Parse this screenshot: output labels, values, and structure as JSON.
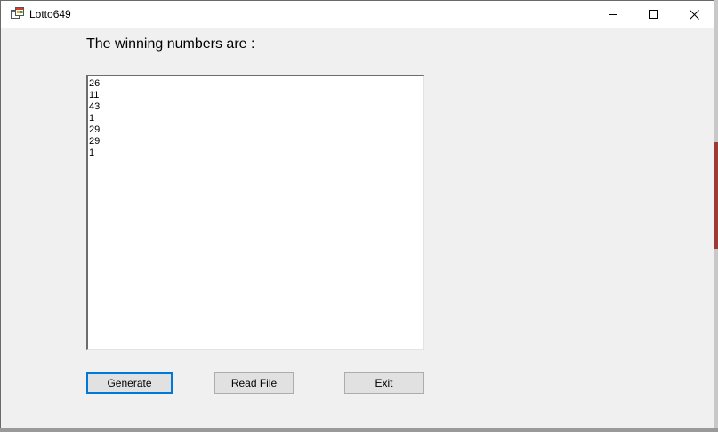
{
  "window": {
    "title": "Lotto649",
    "icon": "windows-form-icon"
  },
  "controls": {
    "minimize": "minimize-icon",
    "maximize": "maximize-icon",
    "close": "close-icon"
  },
  "main": {
    "heading": "The winning numbers are :",
    "numbers": [
      "26",
      "11",
      "43",
      "1",
      "29",
      "29",
      "1"
    ]
  },
  "buttons": {
    "generate": "Generate",
    "read_file": "Read File",
    "exit": "Exit"
  },
  "colors": {
    "focus_border": "#0078d7",
    "window_bg": "#f0f0f0"
  }
}
